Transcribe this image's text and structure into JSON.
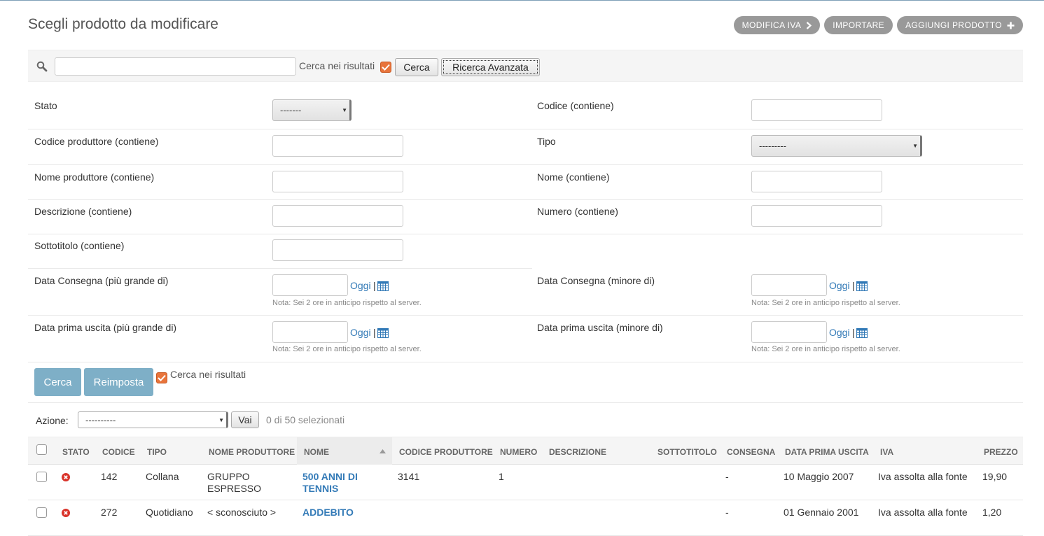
{
  "header": {
    "title": "Scegli prodotto da modificare",
    "tools": [
      {
        "label": "MODIFICA IVA",
        "icon": "chevron-right-icon"
      },
      {
        "label": "IMPORTARE"
      },
      {
        "label": "AGGIUNGI PRODOTTO",
        "icon": "plus-icon"
      }
    ]
  },
  "search": {
    "value": "",
    "in_results_label": "Cerca nei risultati",
    "in_results_checked": true,
    "submit_label": "Cerca",
    "advanced_label": "Ricerca Avanzata"
  },
  "filters": {
    "stato": {
      "label": "Stato",
      "value": "-------"
    },
    "codice": {
      "label": "Codice (contiene)",
      "value": ""
    },
    "codice_produttore": {
      "label": "Codice produttore (contiene)",
      "value": ""
    },
    "tipo": {
      "label": "Tipo",
      "value": "---------"
    },
    "nome_produttore": {
      "label": "Nome produttore (contiene)",
      "value": ""
    },
    "nome": {
      "label": "Nome (contiene)",
      "value": ""
    },
    "descrizione": {
      "label": "Descrizione (contiene)",
      "value": ""
    },
    "numero": {
      "label": "Numero (contiene)",
      "value": ""
    },
    "sottotitolo": {
      "label": "Sottotitolo (contiene)",
      "value": ""
    },
    "consegna_gt": {
      "label": "Data Consegna (più grande di)",
      "today": "Oggi",
      "sep": "|",
      "note": "Nota: Sei 2 ore in anticipo rispetto al server."
    },
    "consegna_lt": {
      "label": "Data Consegna (minore di)",
      "today": "Oggi",
      "sep": "|",
      "note": "Nota: Sei 2 ore in anticipo rispetto al server."
    },
    "uscita_gt": {
      "label": "Data prima uscita (più grande di)",
      "today": "Oggi",
      "sep": "|",
      "note": "Nota: Sei 2 ore in anticipo rispetto al server."
    },
    "uscita_lt": {
      "label": "Data prima uscita (minore di)",
      "today": "Oggi",
      "sep": "|",
      "note": "Nota: Sei 2 ore in anticipo rispetto al server."
    },
    "submit_label": "Cerca",
    "reset_label": "Reimposta",
    "in_results_label": "Cerca nei risultati",
    "in_results_checked": true
  },
  "actions": {
    "label": "Azione:",
    "selected": "----------",
    "go_label": "Vai",
    "count": "0 di 50 selezionati"
  },
  "table": {
    "columns": [
      "STATO",
      "CODICE",
      "TIPO",
      "NOME PRODUTTORE",
      "NOME",
      "CODICE PRODUTTORE",
      "NUMERO",
      "DESCRIZIONE",
      "SOTTOTITOLO",
      "CONSEGNA",
      "DATA PRIMA USCITA",
      "IVA",
      "PREZZO"
    ],
    "sorted_column": "NOME",
    "sort_icon": "sort-asc-icon",
    "rows": [
      {
        "status_icon": "x-circle-icon",
        "codice": "142",
        "tipo": "Collana",
        "produttore_1": "GRUPPO",
        "produttore_2": "ESPRESSO",
        "nome_1": "500 ANNI DI",
        "nome_2": "TENNIS",
        "codice_produttore": "3141",
        "numero": "1",
        "descrizione": "",
        "sottotitolo": "",
        "consegna": "-",
        "uscita": "10 Maggio 2007",
        "iva": "Iva assolta alla fonte",
        "prezzo": "19,90"
      },
      {
        "status_icon": "x-circle-icon",
        "codice": "272",
        "tipo": "Quotidiano",
        "produttore_1": "< sconosciuto >",
        "produttore_2": "",
        "nome_1": "ADDEBITO",
        "nome_2": "",
        "codice_produttore": "",
        "numero": "",
        "descrizione": "",
        "sottotitolo": "",
        "consegna": "-",
        "uscita": "01 Gennaio 2001",
        "iva": "Iva assolta alla fonte",
        "prezzo": "1,20"
      }
    ]
  },
  "colors": {
    "accent": "#337ab7",
    "tool_button": "#999999",
    "primary_button": "#7eafc7",
    "checkbox": "#e8743b",
    "status_error": "#d9342b"
  }
}
